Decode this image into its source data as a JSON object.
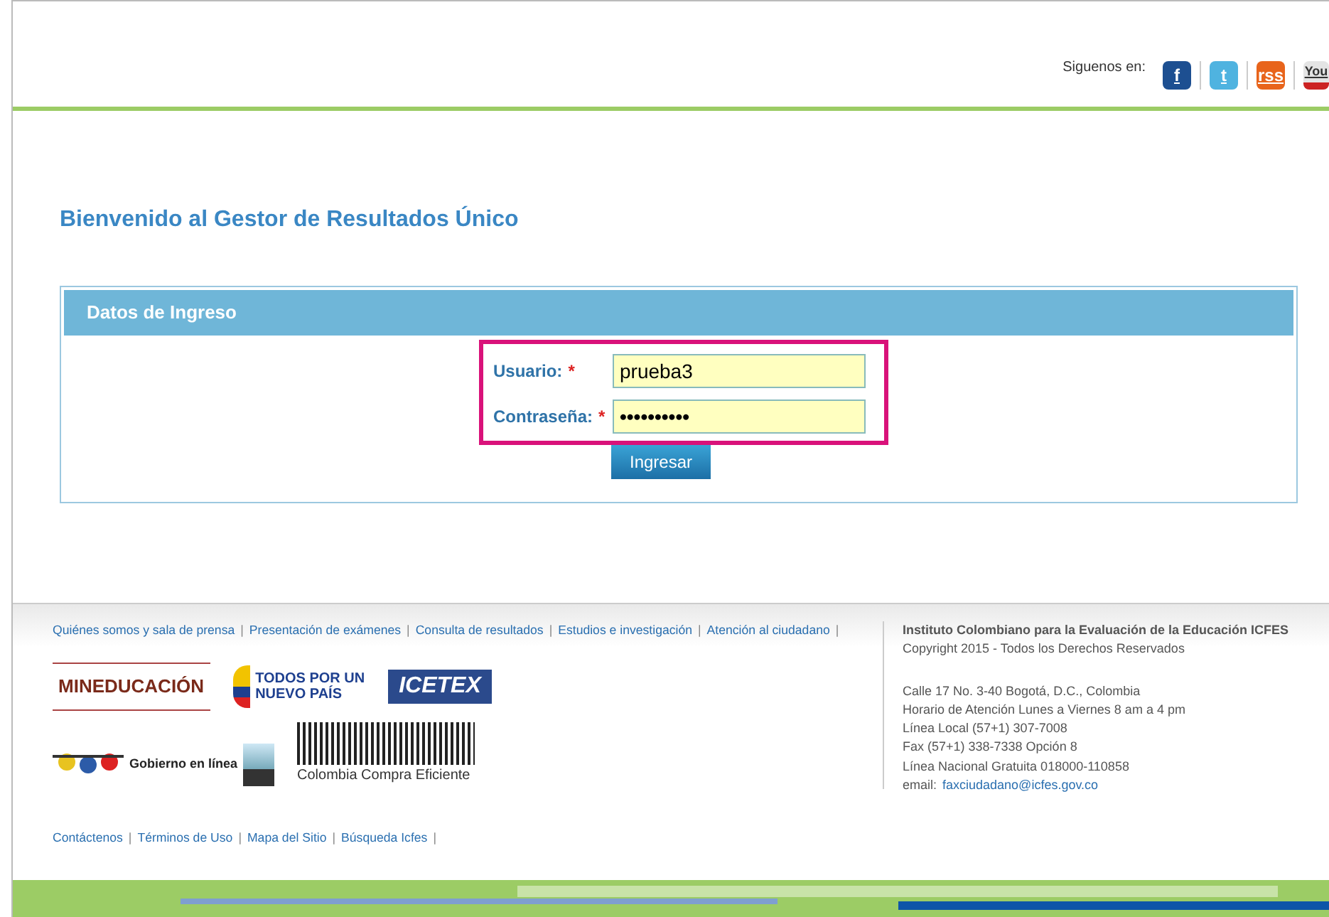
{
  "header": {
    "social_label": "Siguenos en:",
    "social_icons": [
      "f",
      "t",
      "rss",
      "You"
    ]
  },
  "title": "Bienvenido al Gestor de Resultados Único",
  "login_panel": {
    "heading": "Datos de Ingreso",
    "fields": [
      {
        "label": "Usuario:",
        "required_mark": "*",
        "value": "prueba3"
      },
      {
        "label": "Contraseña:",
        "required_mark": "*",
        "value": "••••••••••"
      }
    ],
    "button": "Ingresar"
  },
  "footer": {
    "separator": "|",
    "links": [
      "Quiénes somos y sala de prensa",
      "Presentación de exámenes",
      "Consulta de resultados",
      "Estudios e investigación",
      "Atención al ciudadano"
    ],
    "logos": {
      "mineducacion": "MINEDUCACIÓN",
      "nuevo_pais": [
        "TODOS POR UN",
        "NUEVO PAÍS"
      ],
      "icetex": "ICETEX",
      "gobierno": "Gobierno en línea",
      "compra": "Colombia Compra Eficiente"
    },
    "institute": "Instituto Colombiano para la Evaluación de la Educación ICFES",
    "copyright": "Copyright 2015 - Todos los Derechos Reservados",
    "address_lines": [
      "Calle 17 No. 3-40 Bogotá, D.C., Colombia",
      "Horario de Atención Lunes a Viernes 8 am a 4 pm",
      "Línea Local (57+1) 307-7008",
      "Fax (57+1) 338-7338 Opción 8",
      "Línea Nacional Gratuita 018000-110858"
    ],
    "email_label": "email:",
    "email": "faxciudadano@icfes.gov.co",
    "bottom_links": [
      "Contáctenos",
      "Términos de Uso",
      "Mapa del Sitio",
      "Búsqueda Icfes"
    ]
  }
}
